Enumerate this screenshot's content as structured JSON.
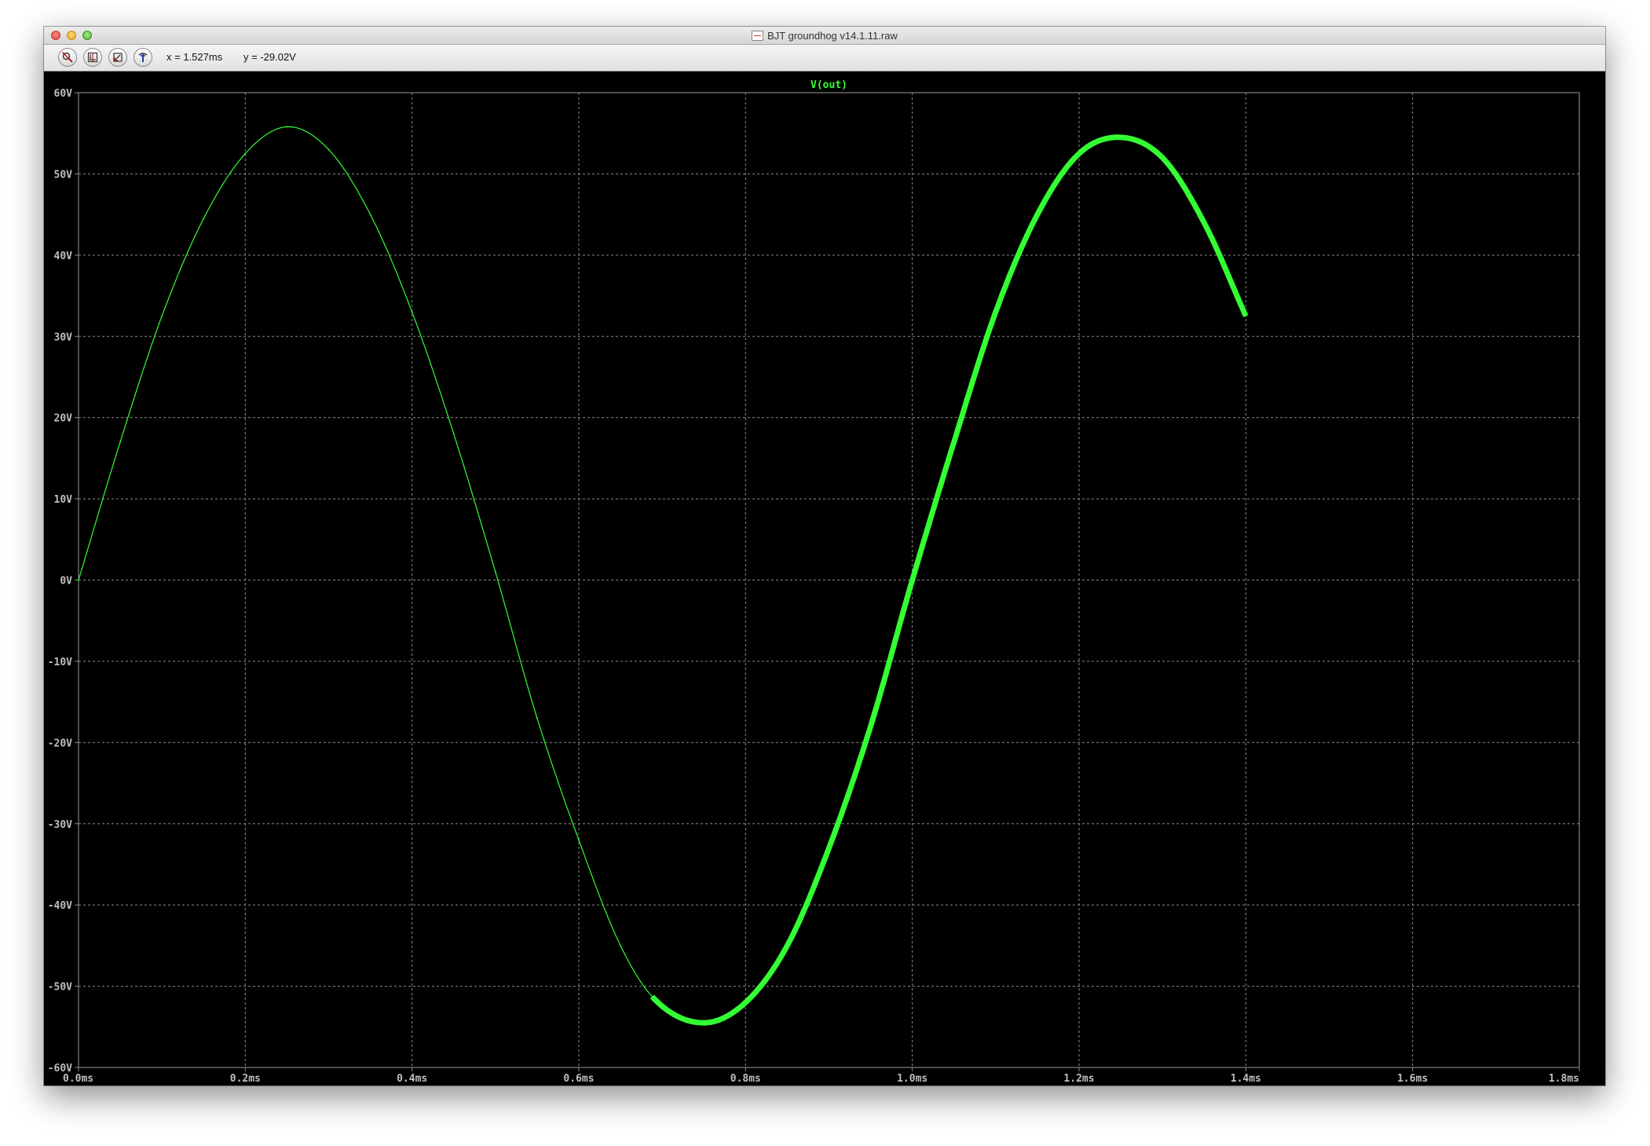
{
  "window": {
    "title": "BJT groundhog v14.1.11.raw"
  },
  "toolbar": {
    "buttons": [
      {
        "name": "zoom-full-button",
        "icon": "zoom-cancel-icon"
      },
      {
        "name": "autoscale-button",
        "icon": "autorange-icon"
      },
      {
        "name": "zoom-back-button",
        "icon": "zoom-back-icon"
      },
      {
        "name": "probe-button",
        "icon": "probe-icon"
      }
    ],
    "cursor_x": "x = 1.527ms",
    "cursor_y": "y = -29.02V"
  },
  "colors": {
    "background": "#000000",
    "trace": "#33ff33",
    "grid": "#8a8a8a",
    "axis_text": "#bfbfbf"
  },
  "chart_data": {
    "type": "line",
    "title": "V(out)",
    "xlabel": "",
    "ylabel": "",
    "xlim": [
      0,
      1.8
    ],
    "ylim": [
      -60,
      60
    ],
    "x_unit": "ms",
    "y_unit": "V",
    "grid": true,
    "x_ticks": [
      "0.0ms",
      "0.2ms",
      "0.4ms",
      "0.6ms",
      "0.8ms",
      "1.0ms",
      "1.2ms",
      "1.4ms",
      "1.6ms",
      "1.8ms"
    ],
    "y_ticks": [
      "60V",
      "50V",
      "40V",
      "30V",
      "20V",
      "10V",
      "0V",
      "-10V",
      "-20V",
      "-30V",
      "-40V",
      "-50V",
      "-60V"
    ],
    "series": [
      {
        "name": "V(out)",
        "x": [
          0.0,
          0.05,
          0.1,
          0.15,
          0.2,
          0.25,
          0.3,
          0.35,
          0.4,
          0.45,
          0.5,
          0.55,
          0.6,
          0.65,
          0.69,
          0.75,
          0.8,
          0.85,
          0.9,
          0.95,
          1.0,
          1.05,
          1.1,
          1.15,
          1.2,
          1.25,
          1.3,
          1.35,
          1.4
        ],
        "y": [
          0.0,
          17.0,
          32.5,
          44.5,
          52.5,
          55.8,
          53.0,
          45.0,
          33.0,
          18.0,
          1.0,
          -17.0,
          -32.0,
          -45.0,
          -51.5,
          -54.5,
          -52.0,
          -45.0,
          -33.0,
          -18.0,
          0.0,
          17.0,
          33.0,
          45.0,
          52.5,
          54.5,
          52.0,
          44.0,
          32.5
        ]
      }
    ]
  }
}
